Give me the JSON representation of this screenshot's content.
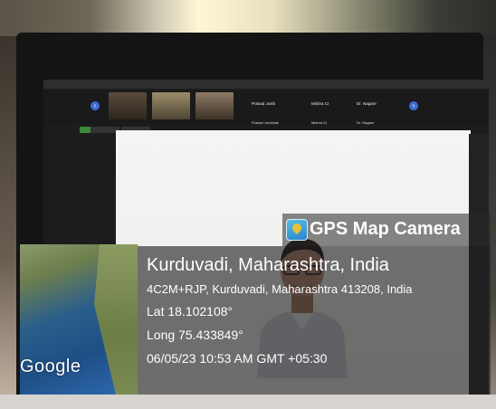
{
  "zoom_window": {
    "participant_labels": [
      "Prasad Joshi",
      "Mishra CI",
      "Dr. Nagare"
    ],
    "participant_small_labels": [
      "Prasad Jondhale",
      "Mishra CI",
      "Dr. Nagare"
    ]
  },
  "gps_overlay": {
    "app_name": "GPS Map Camera",
    "place": "Kurduvadi, Maharashtra, India",
    "address": "4C2M+RJP, Kurduvadi, Maharashtra 413208, India",
    "latitude": "Lat 18.102108°",
    "longitude": "Long 75.433849°",
    "datetime": "06/05/23 10:53 AM GMT +05:30",
    "map_brand": "Google"
  },
  "colors": {
    "nav_arrow": "#3f6bd6",
    "overlay": "#1e1e1e",
    "text": "#ffffff"
  }
}
